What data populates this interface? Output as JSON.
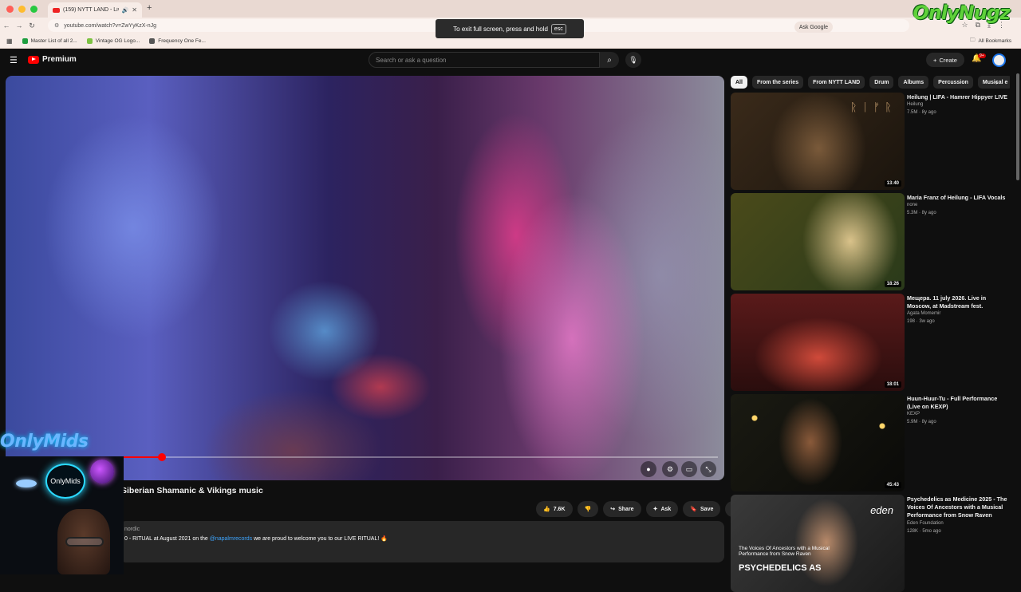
{
  "browser": {
    "tab_title": "(159) NYTT LAND - Live i",
    "url": "youtube.com/watch?v=ZwYyKzX-nJg",
    "ask_google": "Ask Google",
    "bookmarks": [
      "Master List of all 2...",
      "Vintage OG Logo...",
      "Frequency One Fe..."
    ],
    "all_bookmarks": "All Bookmarks",
    "fullscreen_toast": "To exit full screen, press and hold",
    "fullscreen_key": "esc"
  },
  "overlay_logos": {
    "top_right": "OnlyNugz",
    "left": "OnlyMids",
    "badge": "OnlyMids"
  },
  "youtube": {
    "brand": "Premium",
    "search_placeholder": "Search or ask a question",
    "create_label": "Create",
    "notif_count": "9+"
  },
  "video": {
    "title": "Siberian Shamanic & Vikings music",
    "progress_fraction": 0.07,
    "likes": "7.6K",
    "share": "Share",
    "ask": "Ask",
    "save": "Save",
    "desc_channel": "nordic",
    "desc_line_start": "0 - RITUAL at August 2021 on the ",
    "desc_link": "@napalmrecords",
    "desc_line_end": " we are proud to welcome you to our LIVE RITUAL! 🔥"
  },
  "chips": [
    "All",
    "From the series",
    "From NYTT LAND",
    "Drum",
    "Albums",
    "Percussion",
    "Musical e"
  ],
  "recommendations": [
    {
      "title": "Heilung | LIFA - Hamrer Hippyer LIVE",
      "channel": "Heilung",
      "meta": "7.5M · 8y ago",
      "duration": "13:40"
    },
    {
      "title": "Maria Franz of Heilung - LIFA Vocals",
      "channel": "none",
      "meta": "5.3M · 8y ago",
      "duration": "18:26"
    },
    {
      "title": "Мещера. 11 july 2026. Live in Moscow, at Madstream fest.",
      "channel": "Agata Momemir",
      "meta": "198 · 3w ago",
      "duration": "18:01"
    },
    {
      "title": "Huun-Huur-Tu - Full Performance (Live on KEXP)",
      "channel": "KEXP",
      "meta": "5.9M · 8y ago",
      "duration": "45:43"
    },
    {
      "title": "Psychedelics as Medicine 2025 - The Voices Of Ancestors with a Musical Performance from Snow Raven",
      "channel": "Eden Foundation",
      "meta": "128K · 5mo ago",
      "duration": "",
      "thumb_caption": "The Voices Of Ancestors with a Musical Performance from Snow Raven",
      "thumb_big": "PSYCHEDELICS AS",
      "thumb_brand": "eden"
    }
  ]
}
